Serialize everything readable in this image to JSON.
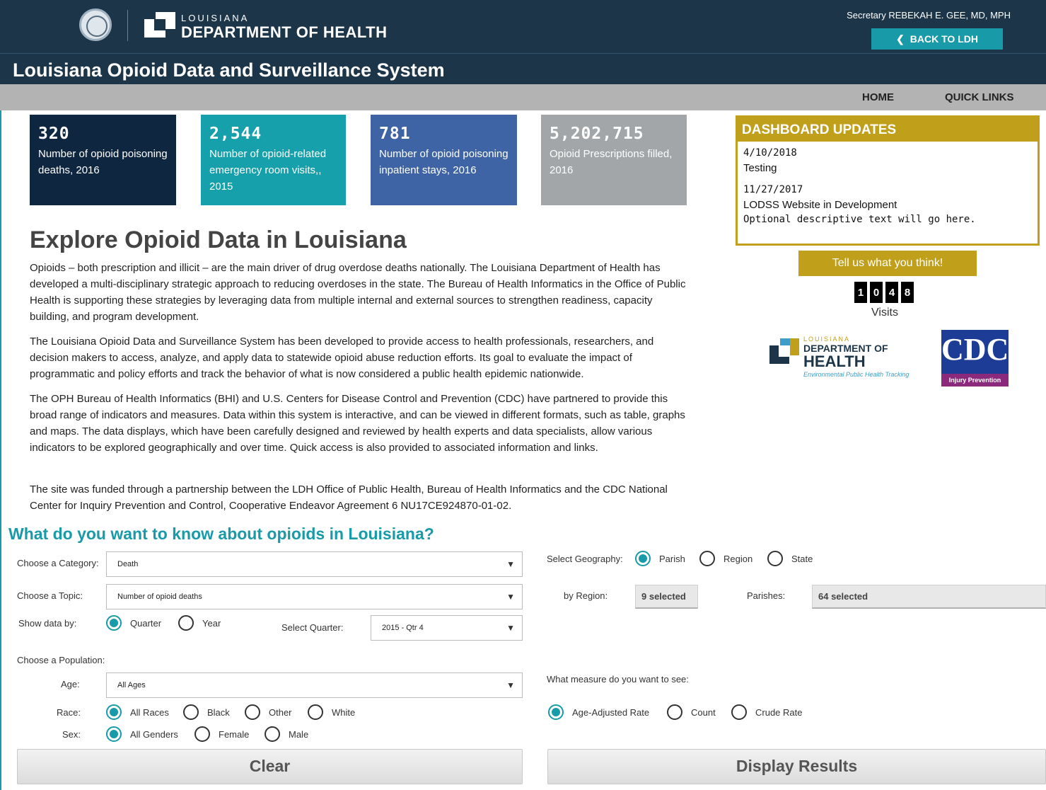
{
  "header": {
    "org_small": "LOUISIANA",
    "org_big": "DEPARTMENT OF HEALTH",
    "secretary": "Secretary REBEKAH E. GEE, MD, MPH",
    "back_label": "BACK TO LDH"
  },
  "title": "Louisiana Opioid Data and Surveillance System",
  "nav": {
    "home": "HOME",
    "quick_links": "QUICK LINKS"
  },
  "stats": [
    {
      "value": "320",
      "label": "Number of opioid poisoning deaths, 2016",
      "color": "#0f2640"
    },
    {
      "value": "2,544",
      "label": "Number of opioid-related emergency room visits,, 2015",
      "color": "#15a0ab"
    },
    {
      "value": "781",
      "label": "Number of opioid poisoning inpatient stays, 2016",
      "color": "#3f64a6"
    },
    {
      "value": "5,202,715",
      "label": "Opioid Prescriptions filled, 2016",
      "color": "#a2a6a8"
    }
  ],
  "dashboard": {
    "heading": "DASHBOARD UPDATES",
    "updates": [
      {
        "date": "4/10/2018",
        "title": "Testing",
        "text": ""
      },
      {
        "date": "11/27/2017",
        "title": "LODSS Website in Development",
        "text": "Optional descriptive text will go here."
      }
    ],
    "feedback_label": "Tell us what you think!",
    "visit_digits": [
      "1",
      "0",
      "4",
      "8"
    ],
    "visits_label": "Visits"
  },
  "logos": {
    "ldh_small": "LOUISIANA",
    "ldh_line1": "DEPARTMENT OF",
    "ldh_line2": "HEALTH",
    "ldh_tag": "Environmental Public Health Tracking",
    "cdc_text": "CDC",
    "cdc_tag": "Injury Prevention"
  },
  "intro": {
    "title": "Explore Opioid Data in Louisiana",
    "paragraphs": [
      "Opioids – both prescription and illicit – are the main driver of drug overdose deaths nationally. The Louisiana Department of Health has developed a multi-disciplinary strategic approach to reducing overdoses in the state. The Bureau of Health Informatics in the Office of Public Health is supporting these strategies by leveraging data from multiple internal and external sources to strengthen readiness, capacity building, and program development.",
      "The Louisiana Opioid Data and Surveillance System has been developed to provide access to health professionals, researchers, and decision makers to access, analyze, and apply data to statewide opioid abuse reduction efforts. Its goal to evaluate the impact of programmatic and policy efforts and track the behavior of what is now considered a public health epidemic nationwide.",
      "The OPH Bureau of Health Informatics (BHI) and U.S. Centers for Disease Control and Prevention (CDC) have partnered to provide this broad range of indicators and measures. Data within this system is interactive, and can be viewed in different formats, such as table, graphs and maps. The data displays, which have been carefully designed and reviewed by health experts and data specialists, allow various indicators to be explored geographically and over time. Quick access is also provided to associated information and links.",
      "The site was funded through a partnership between the LDH Office of Public Health, Bureau of Health Informatics and the CDC National Center for Inquiry Prevention and Control, Cooperative Endeavor Agreement 6 NU17CE924870-01-02."
    ]
  },
  "query": {
    "title": "What do you want to know about opioids in Louisiana?",
    "category_label": "Choose a Category:",
    "category_value": "Death",
    "topic_label": "Choose a Topic:",
    "topic_value": "Number of opioid deaths",
    "showby_label": "Show data by:",
    "showby_options": [
      "Quarter",
      "Year"
    ],
    "quarter_label": "Select Quarter:",
    "quarter_value": "2015 - Qtr 4",
    "population_label": "Choose a Population:",
    "age_label": "Age:",
    "age_value": "All Ages",
    "race_label": "Race:",
    "race_options": [
      "All Races",
      "Black",
      "Other",
      "White"
    ],
    "sex_label": "Sex:",
    "sex_options": [
      "All Genders",
      "Female",
      "Male"
    ],
    "geo_label": "Select Geography:",
    "geo_options": [
      "Parish",
      "Region",
      "State"
    ],
    "region_label": "by Region:",
    "region_value": "9 selected",
    "parishes_label": "Parishes:",
    "parishes_value": "64 selected",
    "measure_label": "What measure do you want to see:",
    "measure_options": [
      "Age-Adjusted Rate",
      "Count",
      "Crude Rate"
    ],
    "clear_label": "Clear",
    "display_label": "Display Results"
  },
  "colors": {
    "navy": "#1c3549",
    "teal": "#189aa8",
    "gold": "#c09f1b",
    "nav_gray": "#b3b3b3"
  }
}
